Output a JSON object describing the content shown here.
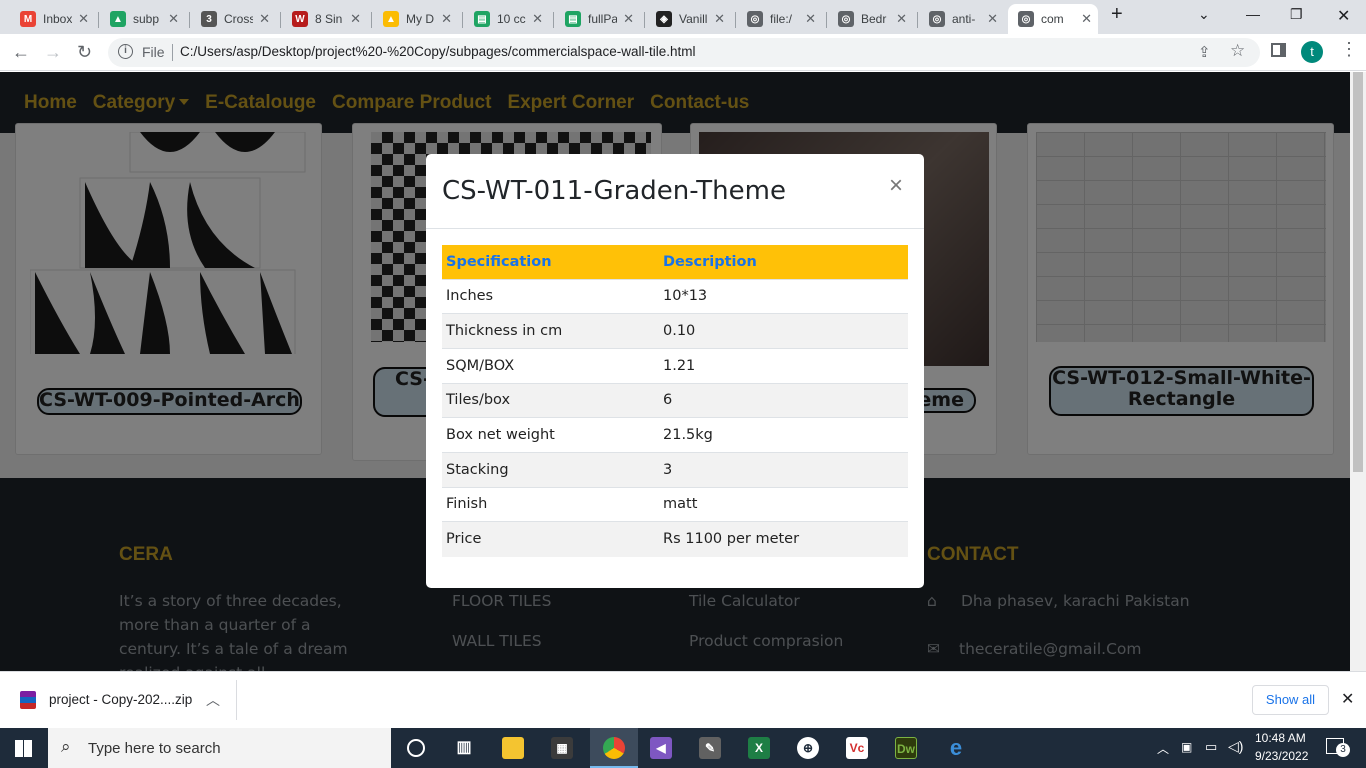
{
  "browser": {
    "tabs": [
      {
        "label": "Inbox",
        "icon": "gmail-icon",
        "color": "#ea4335",
        "glyph": "M"
      },
      {
        "label": "subp",
        "icon": "drive-icon",
        "color": "#1fa463",
        "glyph": "▲"
      },
      {
        "label": "Cross",
        "icon": "css3-icon",
        "color": "#555555",
        "glyph": "3"
      },
      {
        "label": "8 Sin",
        "icon": "w-icon",
        "color": "#b71c1c",
        "glyph": "W"
      },
      {
        "label": "My D",
        "icon": "drive-icon",
        "color": "#fbbc04",
        "glyph": "▲"
      },
      {
        "label": "10 cc",
        "icon": "layout-icon",
        "color": "#1fa463",
        "glyph": "▤"
      },
      {
        "label": "fullPa",
        "icon": "layout-icon",
        "color": "#1fa463",
        "glyph": "▤"
      },
      {
        "label": "Vanill",
        "icon": "codepen-icon",
        "color": "#222222",
        "glyph": "◈"
      },
      {
        "label": "file:/",
        "icon": "globe-icon",
        "color": "#5f6368",
        "glyph": "◎"
      },
      {
        "label": "Bedr",
        "icon": "globe-icon",
        "color": "#5f6368",
        "glyph": "◎"
      },
      {
        "label": "anti-",
        "icon": "globe-icon",
        "color": "#5f6368",
        "glyph": "◎"
      },
      {
        "label": "com",
        "icon": "globe-icon",
        "color": "#5f6368",
        "glyph": "◎"
      }
    ],
    "new_tab": "+",
    "address": {
      "scheme_label": "File",
      "url": "C:/Users/asp/Desktop/project%20-%20Copy/subpages/commercialspace-wall-tile.html"
    },
    "profile_initial": "t"
  },
  "site": {
    "nav": {
      "home": "Home",
      "category": "Category",
      "catalogue": "E-Catalouge",
      "compare": "Compare Product",
      "expert": "Expert Corner",
      "contact": "Contact-us"
    },
    "cards": [
      {
        "label": "CS-WT-009-Pointed-Arch"
      },
      {
        "label": "CS-"
      },
      {
        "label": "eme"
      },
      {
        "label": "CS-WT-012-Small-White-Rectangle"
      }
    ],
    "footer": {
      "brand_title": "CERA",
      "brand_text": "It’s a story of three decades, more than a quarter of a century. It’s a tale of a dream realized against all",
      "links": [
        "FLOOR TILES",
        "WALL TILES"
      ],
      "tools": [
        "Tile Calculator",
        "Product comprasion"
      ],
      "contact_title": "CONTACT",
      "address": "Dha phasev, karachi Pakistan",
      "email": "theceratile@gmail.Com"
    }
  },
  "modal": {
    "title": "CS-WT-011-Graden-Theme",
    "close": "×",
    "headers": [
      "Specification",
      "Description"
    ],
    "rows": [
      [
        "Inches",
        "10*13"
      ],
      [
        "Thickness in cm",
        "0.10"
      ],
      [
        "SQM/BOX",
        "1.21"
      ],
      [
        "Tiles/box",
        "6"
      ],
      [
        "Box net weight",
        "21.5kg"
      ],
      [
        "Stacking",
        "3"
      ],
      [
        "Finish",
        "matt"
      ],
      [
        "Price",
        "Rs 1100 per meter"
      ]
    ]
  },
  "download": {
    "file": "project - Copy-202....zip",
    "show_all": "Show all"
  },
  "taskbar": {
    "search_placeholder": "Type here to search",
    "time": "10:48 AM",
    "date": "9/23/2022",
    "notifications": "3"
  },
  "colors": {
    "gold": "#c9a227",
    "dark": "#1f252b",
    "table_header": "#ffc107",
    "header_text": "#1a73e8"
  }
}
